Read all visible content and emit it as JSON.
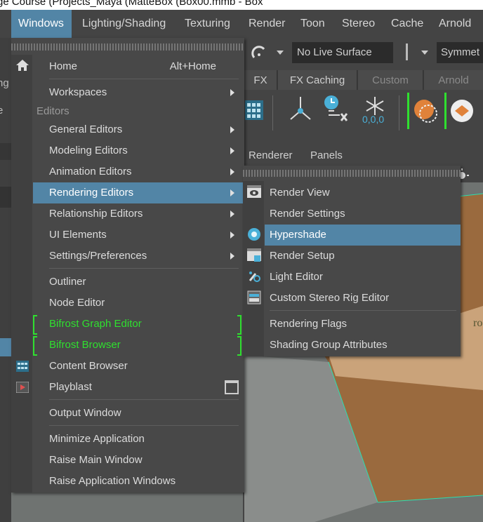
{
  "title_fragment": "ge Course (Projects_Maya (MatteBox (Box00.mmb - Box",
  "menubar": {
    "items": [
      "Windows",
      "Lighting/Shading",
      "Texturing",
      "Render",
      "Toon",
      "Stereo",
      "Cache",
      "Arnold"
    ]
  },
  "statusline": {
    "live_surface": "No Live Surface",
    "symmetry": "Symmet"
  },
  "shelf_tabs": [
    "FX",
    "FX Caching",
    "Custom",
    "Arnold"
  ],
  "shelf_counter": "0,0,0",
  "panel_menu": [
    "Renderer",
    "Panels"
  ],
  "left_edge": {
    "a": "ng",
    "b": "e"
  },
  "windows_menu": {
    "home": {
      "label": "Home",
      "shortcut": "Alt+Home"
    },
    "workspaces": "Workspaces",
    "editors_header": "Editors",
    "submenus": [
      "General Editors",
      "Modeling Editors",
      "Animation Editors",
      "Rendering Editors",
      "Relationship Editors",
      "UI Elements",
      "Settings/Preferences"
    ],
    "items_a": [
      "Outliner",
      "Node Editor"
    ],
    "bifrost": [
      "Bifrost Graph Editor",
      "Bifrost Browser"
    ],
    "items_b": [
      "Content Browser",
      "Playblast"
    ],
    "output": "Output Window",
    "app_items": [
      "Minimize Application",
      "Raise Main Window",
      "Raise Application Windows"
    ],
    "highlighted": "Rendering Editors"
  },
  "rendering_menu": {
    "items": [
      "Render View",
      "Render Settings",
      "Hypershade",
      "Render Setup",
      "Light Editor",
      "Custom Stereo Rig Editor"
    ],
    "items_b": [
      "Rendering Flags",
      "Shading Group Attributes"
    ],
    "highlighted": "Hypershade"
  },
  "viewport_text": "ro",
  "colors": {
    "highlight": "#5285a6",
    "bifrost": "#2fe02f",
    "menu_bg": "#484848"
  }
}
